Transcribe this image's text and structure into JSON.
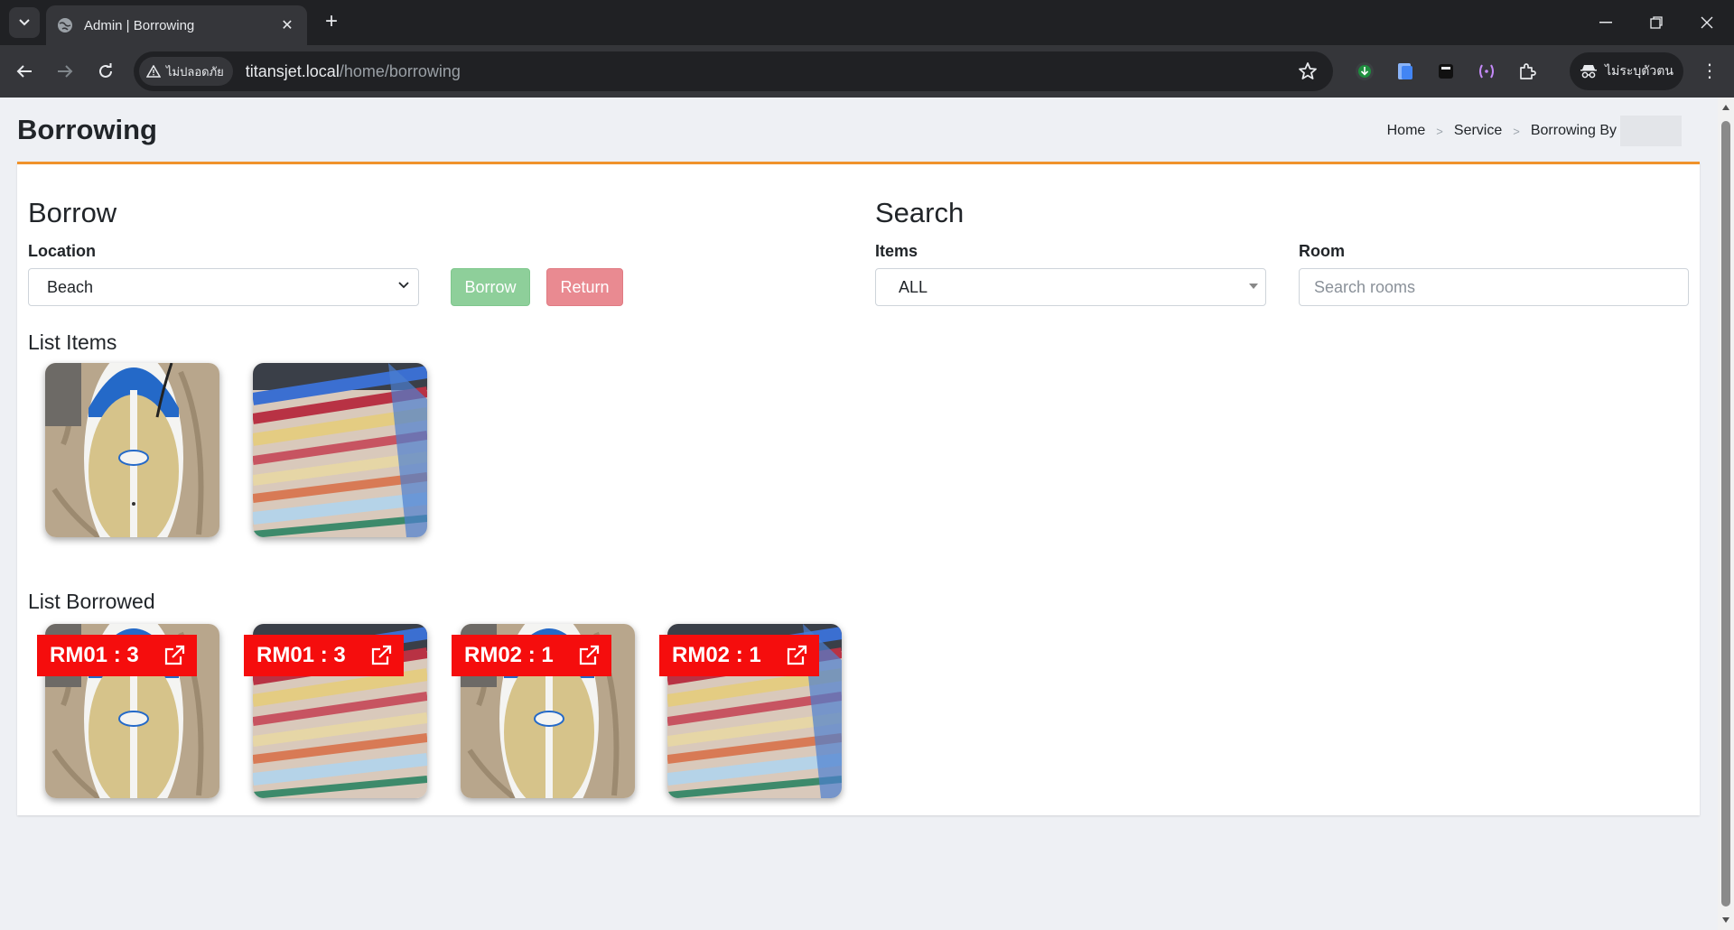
{
  "browser": {
    "tab_title": "Admin | Borrowing",
    "security_label": "ไม่ปลอดภัย",
    "url_host": "titansjet.local",
    "url_path": "/home/borrowing",
    "profile_label": "ไม่ระบุตัวตน"
  },
  "page": {
    "title": "Borrowing",
    "breadcrumb": [
      "Home",
      "Service",
      "Borrowing By"
    ]
  },
  "borrow": {
    "heading": "Borrow",
    "location_label": "Location",
    "location_value": "Beach",
    "borrow_button": "Borrow",
    "return_button": "Return"
  },
  "search": {
    "heading": "Search",
    "items_label": "Items",
    "items_value": "ALL",
    "room_label": "Room",
    "room_placeholder": "Search rooms"
  },
  "list_items": {
    "heading": "List Items",
    "items": [
      {
        "kind": "paddleboard"
      },
      {
        "kind": "towel"
      }
    ]
  },
  "list_borrowed": {
    "heading": "List Borrowed",
    "items": [
      {
        "tag": "RM01 : 3",
        "kind": "paddleboard"
      },
      {
        "tag": "RM01 : 3",
        "kind": "towel"
      },
      {
        "tag": "RM02 : 1",
        "kind": "paddleboard"
      },
      {
        "tag": "RM02 : 1",
        "kind": "towel"
      }
    ]
  },
  "colors": {
    "accent_orange": "#f0922b",
    "borrow_green": "#8ecf9a",
    "return_red": "#e98a91",
    "tag_red": "#f50d0d"
  }
}
